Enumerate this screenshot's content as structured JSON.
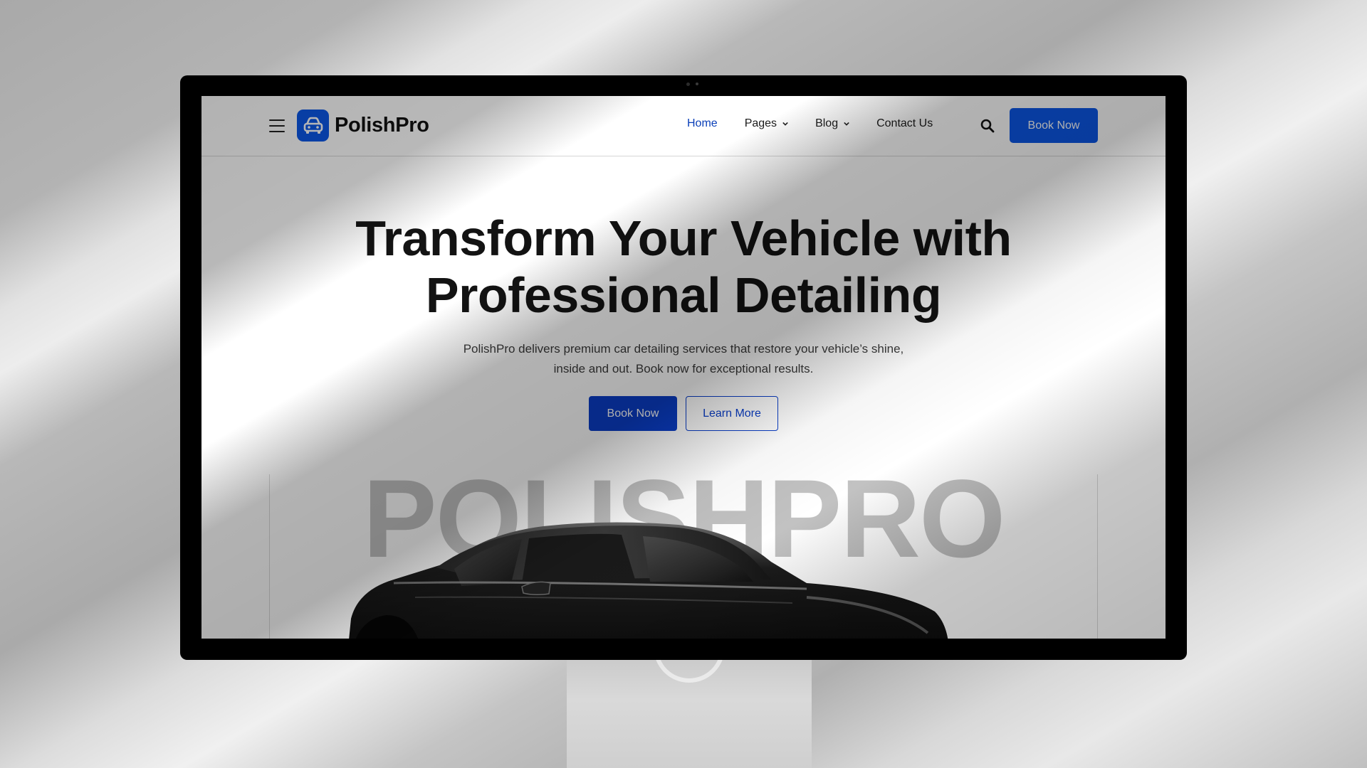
{
  "header": {
    "brand": "PolishPro",
    "nav": [
      {
        "label": "Home",
        "active": true,
        "dropdown": false
      },
      {
        "label": "Pages",
        "active": false,
        "dropdown": true
      },
      {
        "label": "Blog",
        "active": false,
        "dropdown": true
      },
      {
        "label": "Contact Us",
        "active": false,
        "dropdown": false
      }
    ],
    "book_label": "Book Now"
  },
  "hero": {
    "title_line1": "Transform Your Vehicle with",
    "title_line2": "Professional Detailing",
    "subtitle_line1": "PolishPro delivers premium car detailing services that restore your vehicle’s shine,",
    "subtitle_line2": "inside and out. Book now for exceptional results.",
    "primary_label": "Book Now",
    "secondary_label": "Learn More",
    "background_word": "POLISHPRO"
  },
  "icons": {
    "menu": "hamburger-icon",
    "logo": "car-icon",
    "search": "search-icon",
    "caret": "chevron-down-icon"
  },
  "colors": {
    "accent": "#0b57e8",
    "accent_dark": "#0a3ec9",
    "text": "#131313"
  }
}
